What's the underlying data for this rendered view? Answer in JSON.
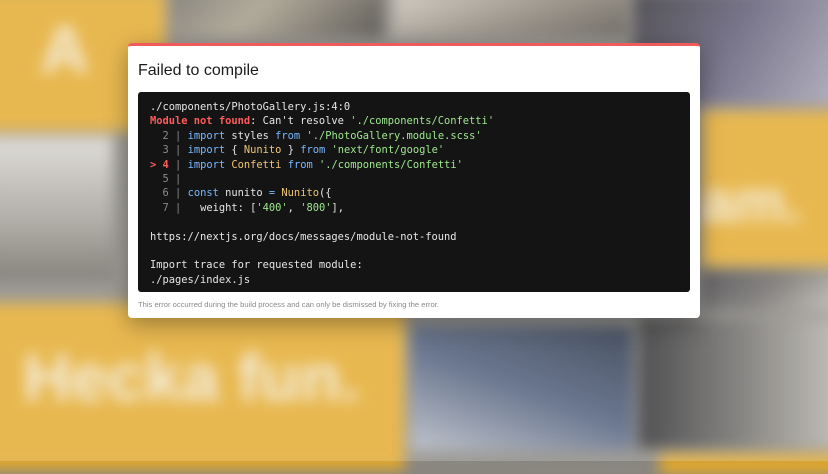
{
  "background": {
    "tile_text_left_top": "A",
    "tile_text_right_mid": "am.",
    "tile_text_bottom_left": "Hecka fun."
  },
  "error_overlay": {
    "title": "Failed to compile",
    "file_location": "./components/PhotoGallery.js:4:0",
    "error_label": "Module not found",
    "error_message": ": Can't resolve ",
    "error_path": "'./components/Confetti'",
    "code_lines": [
      {
        "num": "2",
        "marker": " ",
        "code": [
          {
            "t": "import",
            "c": "kw"
          },
          {
            "t": " styles ",
            "c": ""
          },
          {
            "t": "from",
            "c": "kw"
          },
          {
            "t": " ",
            "c": ""
          },
          {
            "t": "'./PhotoGallery.module.scss'",
            "c": "str"
          }
        ]
      },
      {
        "num": "3",
        "marker": " ",
        "code": [
          {
            "t": "import",
            "c": "kw"
          },
          {
            "t": " { ",
            "c": ""
          },
          {
            "t": "Nunito",
            "c": "ident"
          },
          {
            "t": " } ",
            "c": ""
          },
          {
            "t": "from",
            "c": "kw"
          },
          {
            "t": " ",
            "c": ""
          },
          {
            "t": "'next/font/google'",
            "c": "str"
          }
        ]
      },
      {
        "num": "4",
        "marker": ">",
        "code": [
          {
            "t": "import",
            "c": "kw"
          },
          {
            "t": " ",
            "c": ""
          },
          {
            "t": "Confetti",
            "c": "ident"
          },
          {
            "t": " ",
            "c": ""
          },
          {
            "t": "from",
            "c": "kw"
          },
          {
            "t": " ",
            "c": ""
          },
          {
            "t": "'./components/Confetti'",
            "c": "str"
          }
        ]
      },
      {
        "num": "5",
        "marker": " ",
        "code": []
      },
      {
        "num": "6",
        "marker": " ",
        "code": [
          {
            "t": "const",
            "c": "kw"
          },
          {
            "t": " nunito ",
            "c": ""
          },
          {
            "t": "=",
            "c": "kw"
          },
          {
            "t": " ",
            "c": ""
          },
          {
            "t": "Nunito",
            "c": "ident"
          },
          {
            "t": "({",
            "c": ""
          }
        ]
      },
      {
        "num": "7",
        "marker": " ",
        "code": [
          {
            "t": "  weight: [",
            "c": ""
          },
          {
            "t": "'400'",
            "c": "str"
          },
          {
            "t": ", ",
            "c": ""
          },
          {
            "t": "'800'",
            "c": "str"
          },
          {
            "t": "],",
            "c": ""
          }
        ]
      }
    ],
    "docs_link": "https://nextjs.org/docs/messages/module-not-found",
    "import_trace_label": "Import trace for requested module:",
    "import_trace_file": "./pages/index.js",
    "footer_note": "This error occurred during the build process and can only be dismissed by fixing the error."
  },
  "colors": {
    "accent_top_border": "#ef5b5b",
    "error_red": "#ff5a5a",
    "code_background": "#141414",
    "tile_yellow": "#e3a92a"
  }
}
